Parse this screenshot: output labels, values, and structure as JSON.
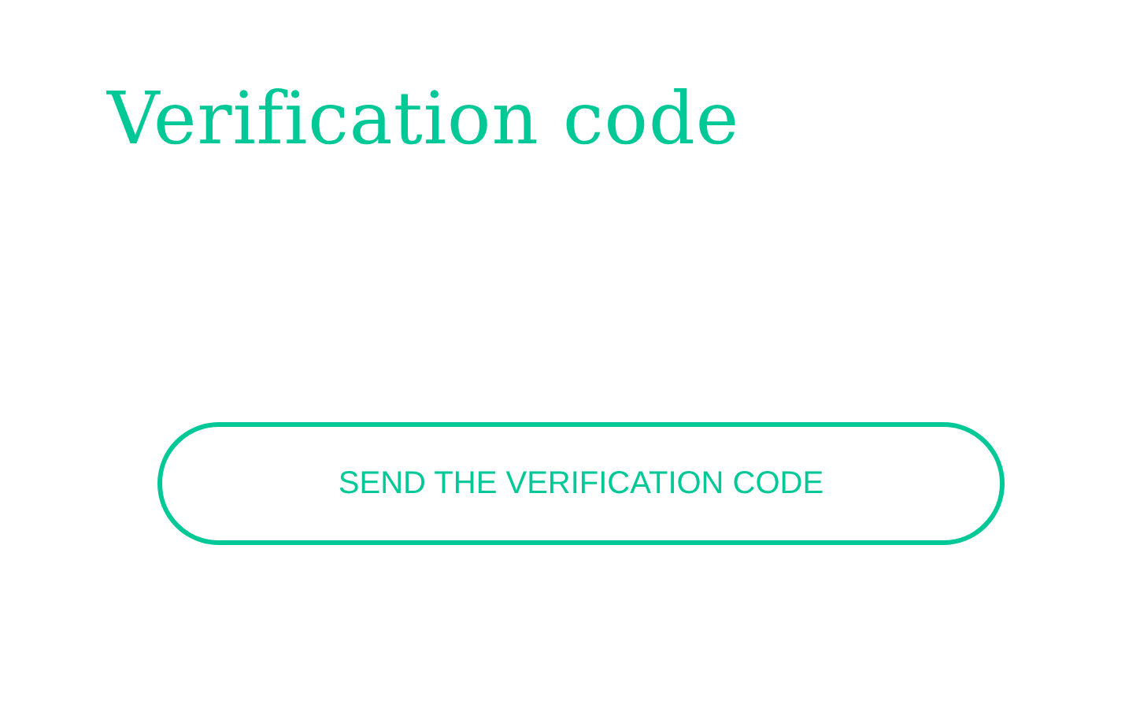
{
  "title": "Verification code",
  "button": {
    "label": "SEND THE VERIFICATION CODE"
  }
}
